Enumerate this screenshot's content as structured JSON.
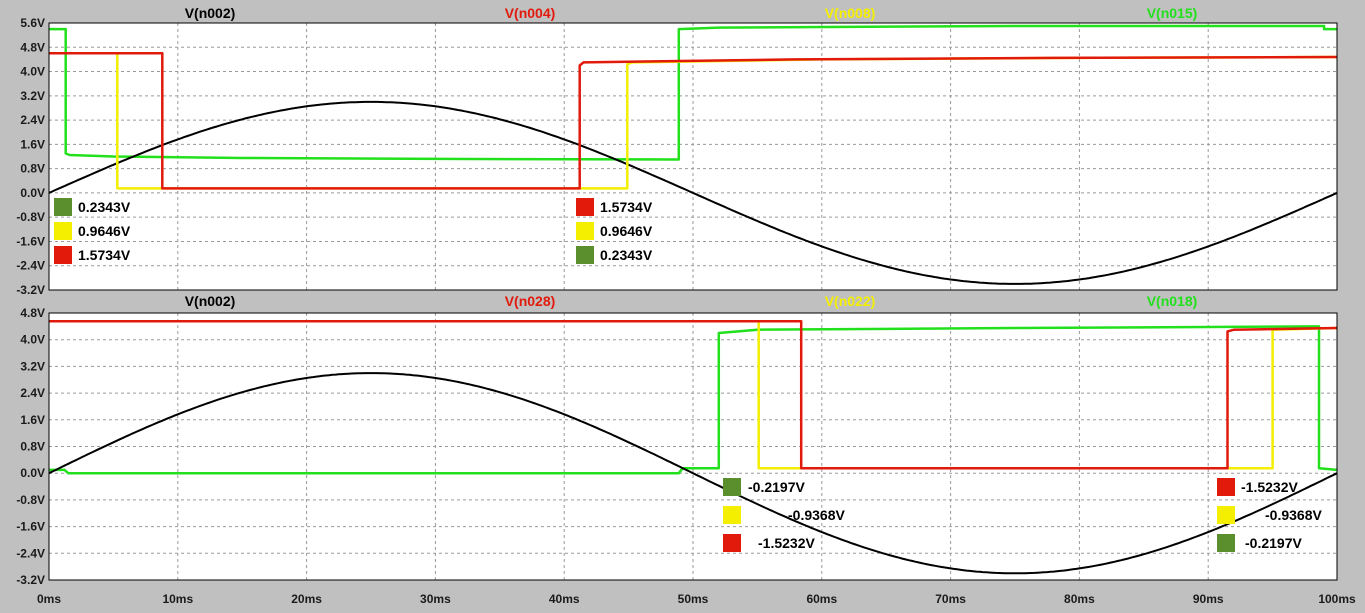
{
  "colors": {
    "background": "#c0c0c0",
    "plot_bg": "#ffffff",
    "grid": "#9a9a9a",
    "black": "#000000",
    "red": "#e11a0c",
    "yellow": "#f4ef00",
    "green": "#22e01c",
    "dark_green": "#5b8f2e"
  },
  "chart_data": [
    {
      "type": "line",
      "panel": "top",
      "xlim": [
        0,
        100
      ],
      "ylim": [
        -3.2,
        5.6
      ],
      "grid": true,
      "x_ticks": [
        0,
        10,
        20,
        30,
        40,
        50,
        60,
        70,
        80,
        90,
        100
      ],
      "x_tick_labels": [
        "0ms",
        "10ms",
        "20ms",
        "30ms",
        "40ms",
        "50ms",
        "60ms",
        "70ms",
        "80ms",
        "90ms",
        "100ms"
      ],
      "y_ticks": [
        5.6,
        4.8,
        4.0,
        3.2,
        2.4,
        1.6,
        0.8,
        0.0,
        -0.8,
        -1.6,
        -2.4,
        -3.2
      ],
      "y_tick_labels": [
        "5.6V",
        "4.8V",
        "4.0V",
        "3.2V",
        "2.4V",
        "1.6V",
        "0.8V",
        "0.0V",
        "-0.8V",
        "-1.6V",
        "-2.4V",
        "-3.2V"
      ],
      "series": [
        {
          "name": "V(n002)",
          "color": "#000000",
          "kind": "sine",
          "amplitude": 3.0,
          "period": 100
        },
        {
          "name": "V(n004)",
          "color": "#e11a0c",
          "kind": "step",
          "points": [
            [
              0,
              4.6
            ],
            [
              8.8,
              4.6
            ],
            [
              8.8,
              0.15
            ],
            [
              41.2,
              0.15
            ],
            [
              41.2,
              4.2
            ],
            [
              41.5,
              4.3
            ],
            [
              58,
              4.4
            ],
            [
              78,
              4.45
            ],
            [
              100,
              4.48
            ]
          ]
        },
        {
          "name": "V(n008)",
          "color": "#f4ef00",
          "kind": "step",
          "points": [
            [
              0,
              4.6
            ],
            [
              5.3,
              4.6
            ],
            [
              5.3,
              0.15
            ],
            [
              44.9,
              0.15
            ],
            [
              44.9,
              4.25
            ],
            [
              45.3,
              4.3
            ],
            [
              60,
              4.4
            ],
            [
              80,
              4.45
            ],
            [
              100,
              4.48
            ]
          ]
        },
        {
          "name": "V(n015)",
          "color": "#22e01c",
          "kind": "step",
          "points": [
            [
              0,
              5.4
            ],
            [
              1.3,
              5.4
            ],
            [
              1.3,
              1.3
            ],
            [
              1.6,
              1.25
            ],
            [
              5,
              1.2
            ],
            [
              15,
              1.15
            ],
            [
              30,
              1.12
            ],
            [
              48.9,
              1.1
            ],
            [
              48.9,
              5.4
            ],
            [
              52,
              5.45
            ],
            [
              75,
              5.5
            ],
            [
              99,
              5.5
            ],
            [
              99,
              5.4
            ],
            [
              100,
              5.4
            ]
          ]
        }
      ],
      "annotations": {
        "left": [
          {
            "swatch": "#5b8f2e",
            "text": "0.2343V"
          },
          {
            "swatch": "#f4ef00",
            "text": "0.9646V"
          },
          {
            "swatch": "#e11a0c",
            "text": "1.5734V"
          }
        ],
        "right": [
          {
            "swatch": "#e11a0c",
            "text": "1.5734V"
          },
          {
            "swatch": "#f4ef00",
            "text": "0.9646V"
          },
          {
            "swatch": "#5b8f2e",
            "text": "0.2343V"
          }
        ]
      }
    },
    {
      "type": "line",
      "panel": "bottom",
      "xlim": [
        0,
        100
      ],
      "ylim": [
        -3.2,
        4.8
      ],
      "grid": true,
      "x_ticks": [
        0,
        10,
        20,
        30,
        40,
        50,
        60,
        70,
        80,
        90,
        100
      ],
      "x_tick_labels": [
        "0ms",
        "10ms",
        "20ms",
        "30ms",
        "40ms",
        "50ms",
        "60ms",
        "70ms",
        "80ms",
        "90ms",
        "100ms"
      ],
      "y_ticks": [
        4.8,
        4.0,
        3.2,
        2.4,
        1.6,
        0.8,
        0.0,
        -0.8,
        -1.6,
        -2.4,
        -3.2
      ],
      "y_tick_labels": [
        "4.8V",
        "4.0V",
        "3.2V",
        "2.4V",
        "1.6V",
        "0.8V",
        "0.0V",
        "-0.8V",
        "-1.6V",
        "-2.4V",
        "-3.2V"
      ],
      "series": [
        {
          "name": "V(n002)",
          "color": "#000000",
          "kind": "sine",
          "amplitude": 3.0,
          "period": 100
        },
        {
          "name": "V(n028)",
          "color": "#e11a0c",
          "kind": "step",
          "points": [
            [
              0,
              4.55
            ],
            [
              58.4,
              4.55
            ],
            [
              58.4,
              0.15
            ],
            [
              91.5,
              0.15
            ],
            [
              91.5,
              4.25
            ],
            [
              92,
              4.3
            ],
            [
              100,
              4.35
            ]
          ]
        },
        {
          "name": "V(n022)",
          "color": "#f4ef00",
          "kind": "step",
          "points": [
            [
              0,
              4.55
            ],
            [
              55.1,
              4.55
            ],
            [
              55.1,
              0.15
            ],
            [
              95,
              0.15
            ],
            [
              95,
              4.3
            ],
            [
              100,
              4.35
            ]
          ]
        },
        {
          "name": "V(n018)",
          "color": "#22e01c",
          "kind": "step",
          "points": [
            [
              0,
              0.1
            ],
            [
              1.2,
              0.1
            ],
            [
              1.5,
              0.0
            ],
            [
              48.9,
              0.0
            ],
            [
              49.2,
              0.15
            ],
            [
              52,
              0.15
            ],
            [
              52,
              4.2
            ],
            [
              55,
              4.3
            ],
            [
              75,
              4.35
            ],
            [
              98.6,
              4.4
            ],
            [
              98.6,
              0.15
            ],
            [
              100,
              0.1
            ]
          ]
        }
      ],
      "annotations": {
        "left": [
          {
            "swatch": "#5b8f2e",
            "text": "-0.2197V"
          },
          {
            "swatch": "#f4ef00",
            "text": "-0.9368V"
          },
          {
            "swatch": "#e11a0c",
            "text": "-1.5232V"
          }
        ],
        "right": [
          {
            "swatch": "#e11a0c",
            "text": "-1.5232V"
          },
          {
            "swatch": "#f4ef00",
            "text": "-0.9368V"
          },
          {
            "swatch": "#5b8f2e",
            "text": "-0.2197V"
          }
        ]
      }
    }
  ]
}
